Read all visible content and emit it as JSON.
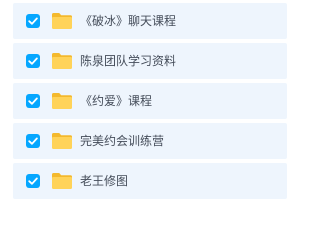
{
  "file_list": {
    "items": [
      {
        "name": "《破冰》聊天课程",
        "checked": true
      },
      {
        "name": "陈泉团队学习资料",
        "checked": true
      },
      {
        "name": "《约爱》课程",
        "checked": true
      },
      {
        "name": "完美约会训练营",
        "checked": true
      },
      {
        "name": "老王修图",
        "checked": true
      }
    ]
  },
  "colors": {
    "row_background": "#eef5fd",
    "checkbox_checked": "#06a7ff",
    "folder_front": "#ffd359",
    "folder_back": "#f4b92e",
    "text": "#454d5a"
  },
  "icons": {
    "checkbox": "checkmark-icon",
    "folder": "folder-icon"
  }
}
